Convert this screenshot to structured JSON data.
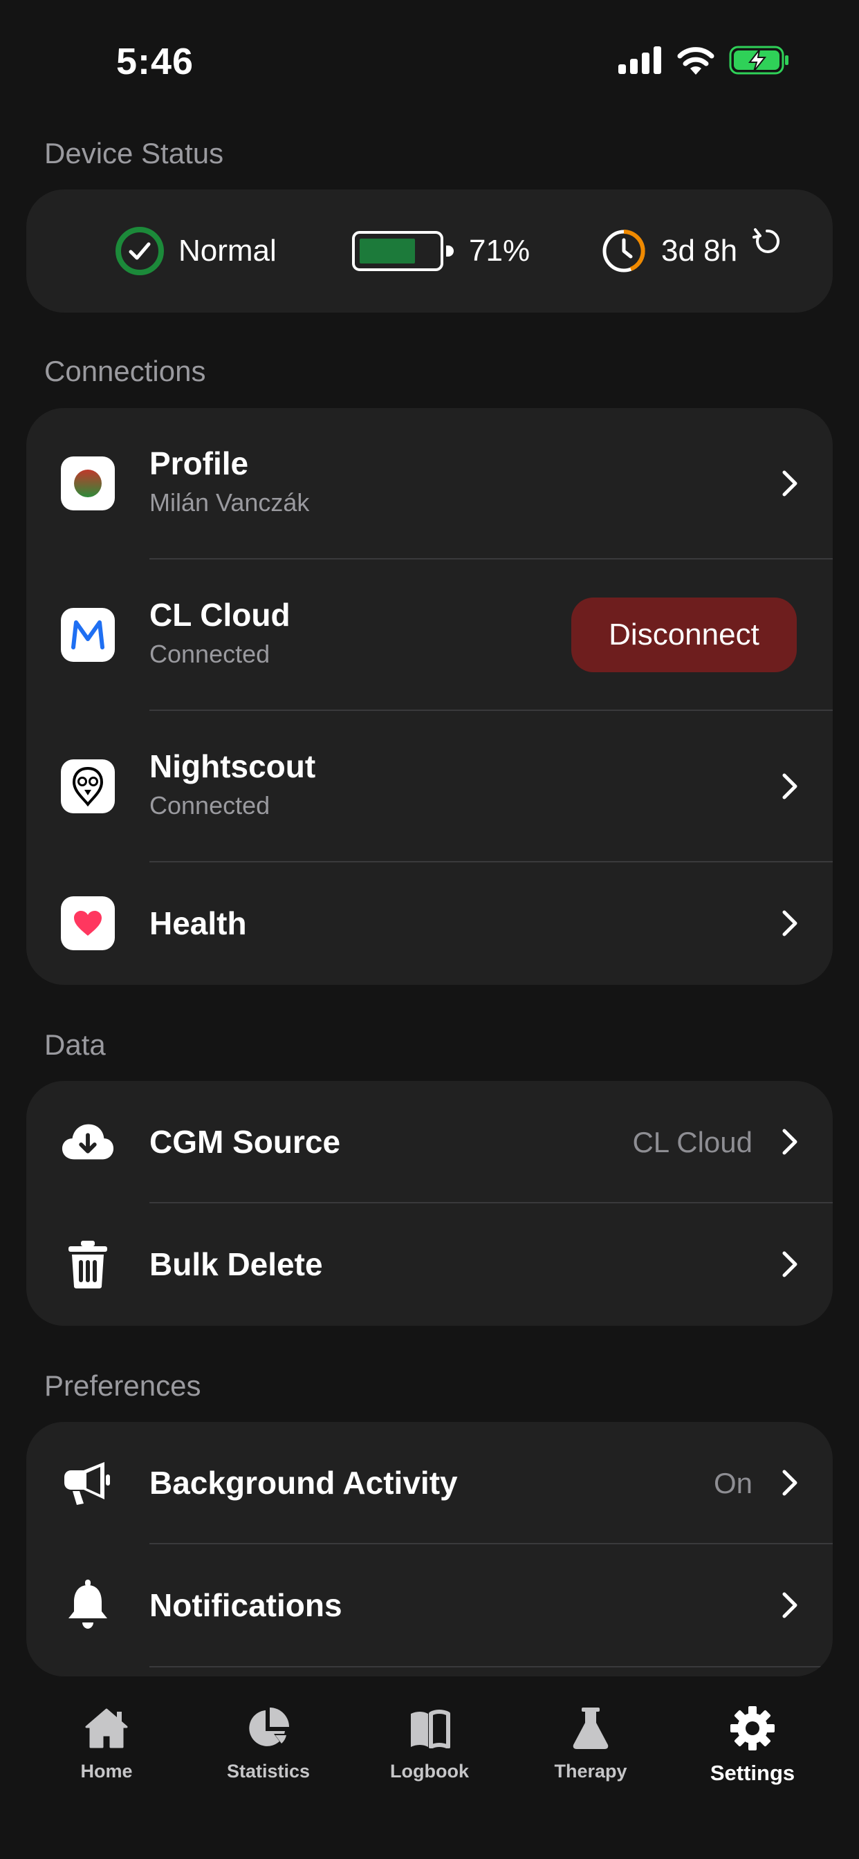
{
  "status_bar": {
    "time": "5:46",
    "icons": [
      "cellular-signal-icon",
      "wifi-icon",
      "battery-charging-icon"
    ]
  },
  "device_status": {
    "section_title": "Device Status",
    "state": "Normal",
    "battery_percent": "71%",
    "battery_level": 0.71,
    "sensor_time_left": "3d 8h",
    "colors": {
      "ok": "#1c8a3a",
      "battery": "#1c7a3a",
      "timer": "#f08a00"
    }
  },
  "connections": {
    "section_title": "Connections",
    "profile": {
      "title": "Profile",
      "subtitle": "Milán Vanczák"
    },
    "cl_cloud": {
      "title": "CL Cloud",
      "subtitle": "Connected",
      "button": "Disconnect"
    },
    "nightscout": {
      "title": "Nightscout",
      "subtitle": "Connected"
    },
    "health": {
      "title": "Health"
    }
  },
  "data": {
    "section_title": "Data",
    "cgm_source": {
      "title": "CGM Source",
      "value": "CL Cloud"
    },
    "bulk_delete": {
      "title": "Bulk Delete"
    }
  },
  "preferences": {
    "section_title": "Preferences",
    "background_activity": {
      "title": "Background Activity",
      "value": "On"
    },
    "notifications": {
      "title": "Notifications"
    }
  },
  "tabbar": {
    "items": [
      {
        "label": "Home",
        "icon": "house-icon"
      },
      {
        "label": "Statistics",
        "icon": "pie-chart-icon"
      },
      {
        "label": "Logbook",
        "icon": "book-icon"
      },
      {
        "label": "Therapy",
        "icon": "flask-icon"
      },
      {
        "label": "Settings",
        "icon": "gear-icon",
        "active": true
      }
    ]
  }
}
